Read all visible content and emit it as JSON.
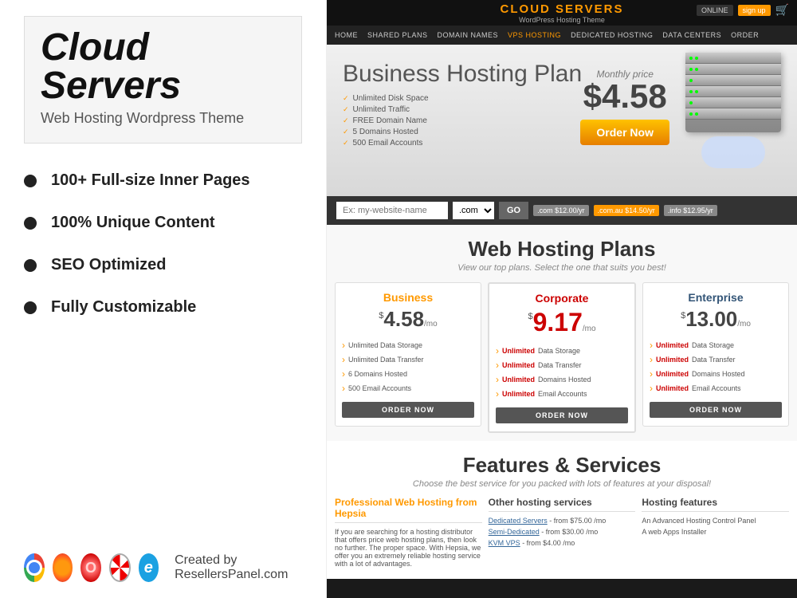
{
  "left": {
    "main_title": "Cloud Servers",
    "subtitle": "Web Hosting Wordpress Theme",
    "features": [
      "100+ Full-size Inner Pages",
      "100% Unique Content",
      "SEO Optimized",
      "Fully Customizable"
    ],
    "created_by": "Created by ResellersPanel.com"
  },
  "right": {
    "top_bar": {
      "title": "CLOUD SERVERS",
      "subtitle": "WordPress Hosting Theme",
      "btn_label": "sign up",
      "online_label": "ONLINE"
    },
    "nav": {
      "items": [
        "HOME",
        "SHARED PLANS",
        "DOMAIN NAMES",
        "VPS HOSTING",
        "DEDICATED HOSTING",
        "DATA CENTERS",
        "ORDER"
      ]
    },
    "hero": {
      "title": "Business Hosting Plan",
      "features": [
        "Unlimited Disk Space",
        "Unlimited Traffic",
        "FREE Domain Name",
        "5 Domains Hosted",
        "500 Email Accounts"
      ],
      "monthly_price_label": "Monthly price",
      "price": "$4.58",
      "order_btn": "Order Now"
    },
    "domain_search": {
      "placeholder": "Ex: my-website-name",
      "extension": ".com",
      "go_btn": "GO",
      "prices": [
        {
          "label": ".com",
          "price": "$12.00/yr"
        },
        {
          "label": ".com.au",
          "price": "$14.50/yr"
        },
        {
          "label": ".info",
          "price": "$12.95/yr"
        }
      ]
    },
    "plans": {
      "title": "Web Hosting Plans",
      "subtitle": "View our top plans. Select the one that suits you best!",
      "columns": [
        {
          "name": "Business",
          "price_dollar": "$",
          "price_amount": "4.58",
          "price_period": "/mo",
          "features": [
            "Unlimited Data Storage",
            "Unlimited Data Transfer",
            "6 Domains Hosted",
            "500 Email Accounts"
          ],
          "order_btn": "ORDER NOW"
        },
        {
          "name": "Corporate",
          "price_dollar": "$",
          "price_amount": "9.17",
          "price_period": "/mo",
          "features": [
            "Unlimited Data Storage",
            "Unlimited Data Transfer",
            "Unlimited Domains Hosted",
            "Unlimited Email Accounts"
          ],
          "order_btn": "ORDER NOW",
          "featured": true
        },
        {
          "name": "Enterprise",
          "price_dollar": "$",
          "price_amount": "13.00",
          "price_period": "/mo",
          "features": [
            "Unlimited Data Storage",
            "Unlimited Data Transfer",
            "Unlimited Domains Hosted",
            "Unlimited Email Accounts"
          ],
          "order_btn": "ORDER NOW"
        }
      ]
    },
    "features_section": {
      "title": "Features & Services",
      "subtitle": "Choose the best service for you packed with lots of features at your disposal!",
      "columns": [
        {
          "title": "Professional Web Hosting from Hepsia",
          "items": [
            "If you are searching for a hosting distributor that offers price web hosting plans, then look no further. The proper space. With Hepsia, we offer you an extremely reliable hosting service with a lot of advantages."
          ]
        },
        {
          "title": "Other hosting services",
          "items": [
            "Dedicated Servers - from $75.00 /mo",
            "Semi-Dedicated - from $30.00 /mo",
            "KVM VPS - from $4.00 /mo"
          ]
        },
        {
          "title": "Hosting features",
          "items": [
            "An Advanced Hosting Control Panel",
            "A web Apps Installer"
          ]
        }
      ]
    }
  }
}
